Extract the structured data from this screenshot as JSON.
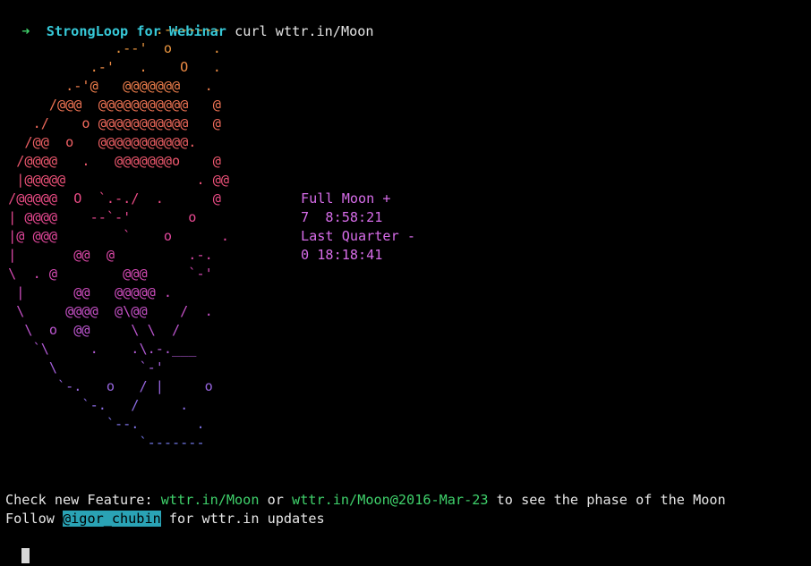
{
  "prompt": {
    "arrow": "➜",
    "title": "StrongLoop for Webinar",
    "command": "curl wttr.in/Moon"
  },
  "moon_art": [
    "                   .-------",
    "              .--'  o     .",
    "           .-'   .    O   .",
    "        .-'@   @@@@@@@   .",
    "      /@@@  @@@@@@@@@@@   @",
    "    ./    o @@@@@@@@@@@   @",
    "   /@@  o   @@@@@@@@@@@.",
    "  /@@@@   .   @@@@@@@o    @",
    "  |@@@@@                . @@",
    " /@@@@@  O  `.-./  .      @",
    " | @@@@    --`-'       o",
    " |@ @@@        `    o      .",
    " |       @@  @         .-.",
    " \\  . @        @@@     `-'",
    "  |      @@   @@@@@ .",
    "  \\     @@@@  @\\@@    /  .",
    "   \\  o  @@     \\ \\  /",
    "    `\\     .    .\\.-.___",
    "      \\          `-'",
    "       `-.   o   / |     o",
    "          `-.   /     .",
    "             `--.       .",
    "                 `-------"
  ],
  "moon_colors": [
    "#e8a43c",
    "#e8943f",
    "#ec8a44",
    "#ef7f4c",
    "#f07454",
    "#f06a5c",
    "#ef6064",
    "#ee586e",
    "#ec5178",
    "#e94b84",
    "#e64890",
    "#e2479c",
    "#dc48a8",
    "#d64ab4",
    "#cf4dbf",
    "#c751c8",
    "#bd56d0",
    "#b25bd6",
    "#a560dc",
    "#9866e0",
    "#8b6ce4",
    "#7e72e6",
    "#7278e8"
  ],
  "moon_info": [
    "Full Moon +",
    "7  8:58:21",
    "Last Quarter -",
    "0 18:18:41"
  ],
  "footer": {
    "feature_prefix": "Check new Feature: ",
    "feature_link1": "wttr.in/Moon",
    "feature_or": " or ",
    "feature_link2": "wttr.in/Moon@2016-Mar-23",
    "feature_suffix": " to see the phase of the Moon",
    "follow_prefix": "Follow ",
    "follow_handle": "@igor_chubin",
    "follow_suffix": " for wttr.in updates"
  }
}
